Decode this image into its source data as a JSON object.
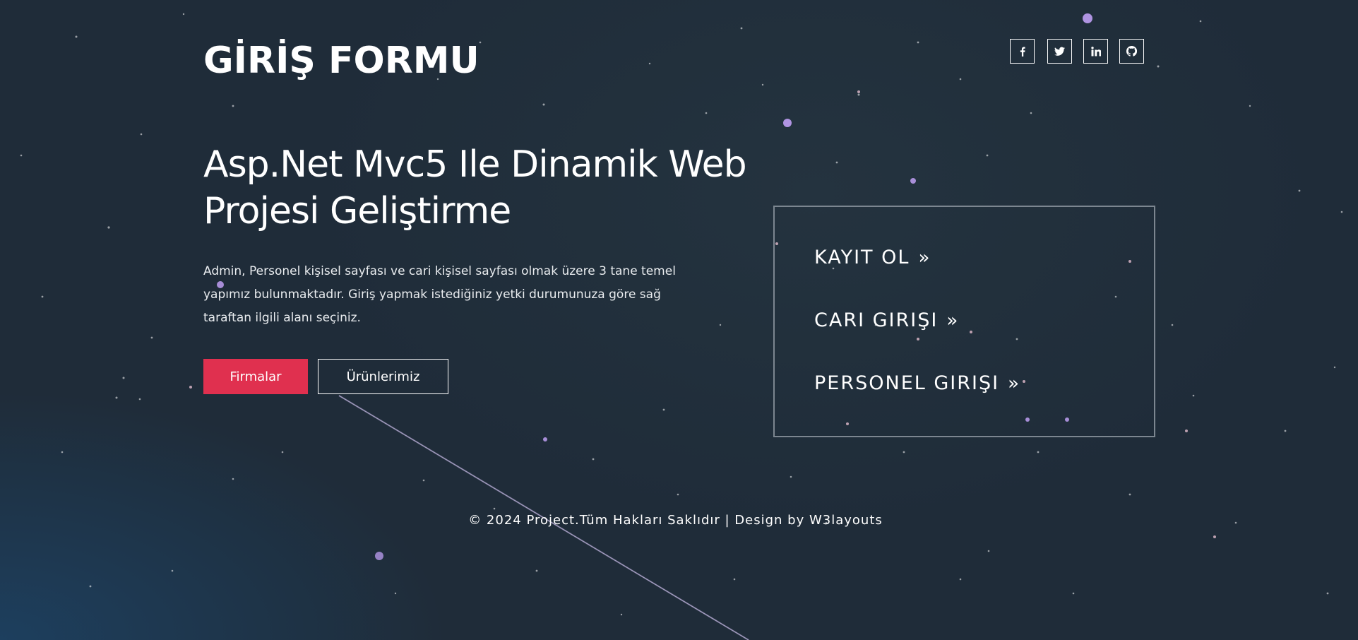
{
  "header": {
    "logo": "GİRİŞ FORMU",
    "social": [
      {
        "icon": "facebook-icon",
        "glyph": "f"
      },
      {
        "icon": "twitter-icon",
        "glyph": "t"
      },
      {
        "icon": "linkedin-icon",
        "glyph": "in"
      },
      {
        "icon": "github-icon",
        "glyph": "gh"
      }
    ]
  },
  "hero": {
    "title": "Asp.Net Mvc5 Ile Dinamik Web Projesi Geliştirme",
    "description": "Admin, Personel kişisel sayfası ve cari kişisel sayfası olmak üzere 3 tane temel yapımız bulunmaktadır. Giriş yapmak istediğiniz yetki durumunuza göre sağ taraftan ilgili alanı seçiniz.",
    "primary_button": "Firmalar",
    "secondary_button": "Ürünlerimiz"
  },
  "login_box": {
    "links": [
      {
        "label": "KAYIT OL",
        "chevron": "»"
      },
      {
        "label": "CARI GIRIŞI",
        "chevron": "»"
      },
      {
        "label": "PERSONEL GIRIŞI",
        "chevron": "»"
      }
    ]
  },
  "footer": {
    "text": "© 2024 Project.Tüm Hakları Saklıdır | Design by W3layouts"
  },
  "colors": {
    "accent": "#e0304f",
    "background": "#1f2c39",
    "text": "#ffffff"
  }
}
